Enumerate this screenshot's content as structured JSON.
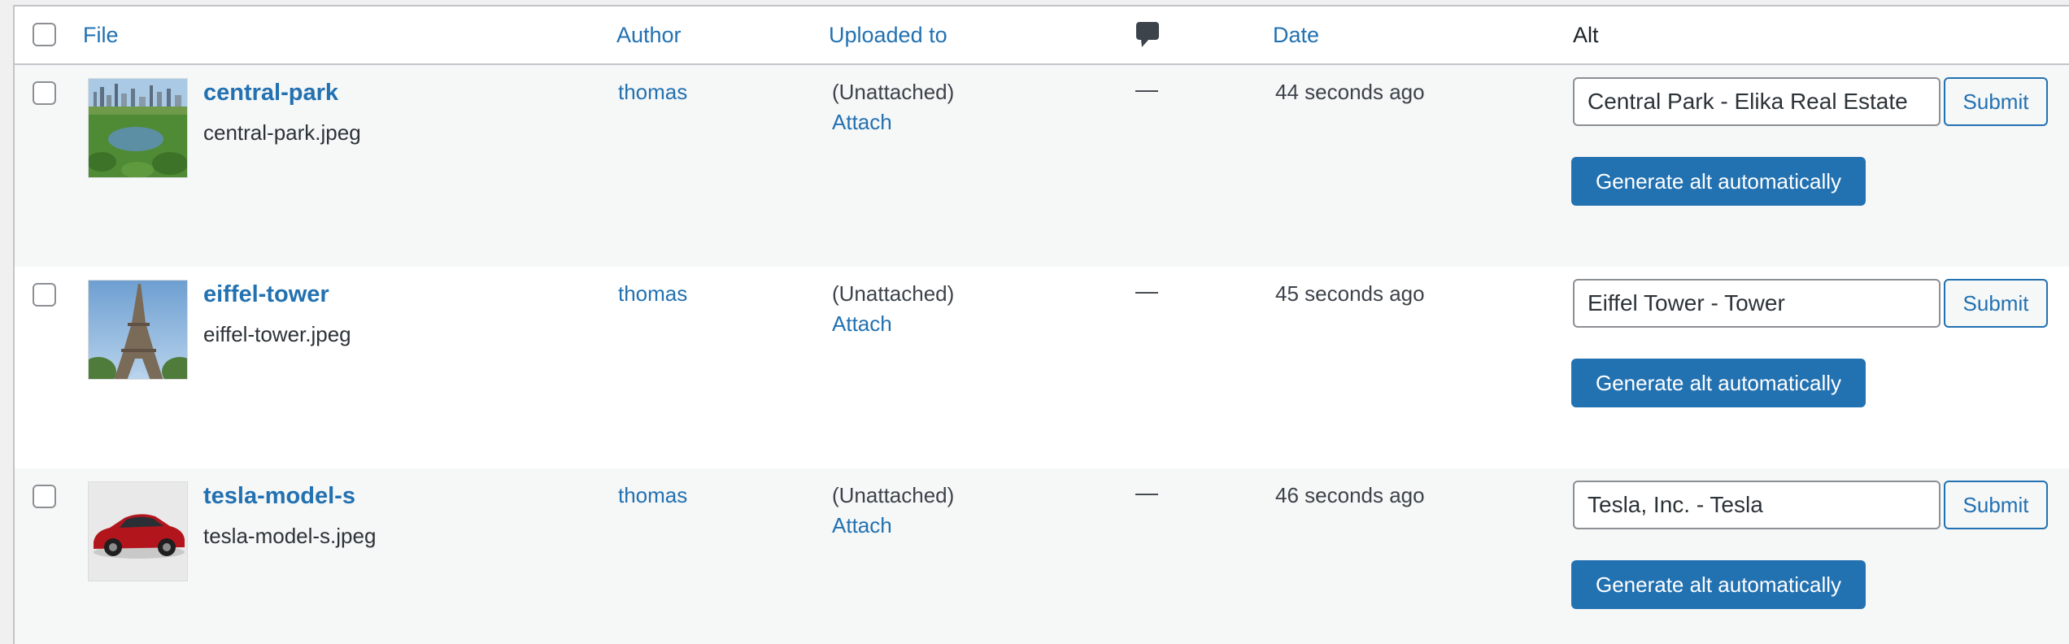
{
  "columns": {
    "file": "File",
    "author": "Author",
    "uploaded_to": "Uploaded to",
    "comments_icon": "comment-bubble-icon",
    "date": "Date",
    "alt": "Alt"
  },
  "rows": [
    {
      "title": "central-park",
      "filename": "central-park.jpeg",
      "author": "thomas",
      "uploaded": "(Unattached)",
      "attach": "Attach",
      "comments": "—",
      "date": "44 seconds ago",
      "alt_value": "Central Park - Elika Real Estate",
      "submit": "Submit",
      "generate": "Generate alt automatically"
    },
    {
      "title": "eiffel-tower",
      "filename": "eiffel-tower.jpeg",
      "author": "thomas",
      "uploaded": "(Unattached)",
      "attach": "Attach",
      "comments": "—",
      "date": "45 seconds ago",
      "alt_value": "Eiffel Tower - Tower",
      "submit": "Submit",
      "generate": "Generate alt automatically"
    },
    {
      "title": "tesla-model-s",
      "filename": "tesla-model-s.jpeg",
      "author": "thomas",
      "uploaded": "(Unattached)",
      "attach": "Attach",
      "comments": "—",
      "date": "46 seconds ago",
      "alt_value": "Tesla, Inc. - Tesla",
      "submit": "Submit",
      "generate": "Generate alt automatically"
    }
  ],
  "colors": {
    "link": "#2271b1",
    "button_primary": "#2271b1",
    "row_alt_bg": "#f6f7f7"
  }
}
